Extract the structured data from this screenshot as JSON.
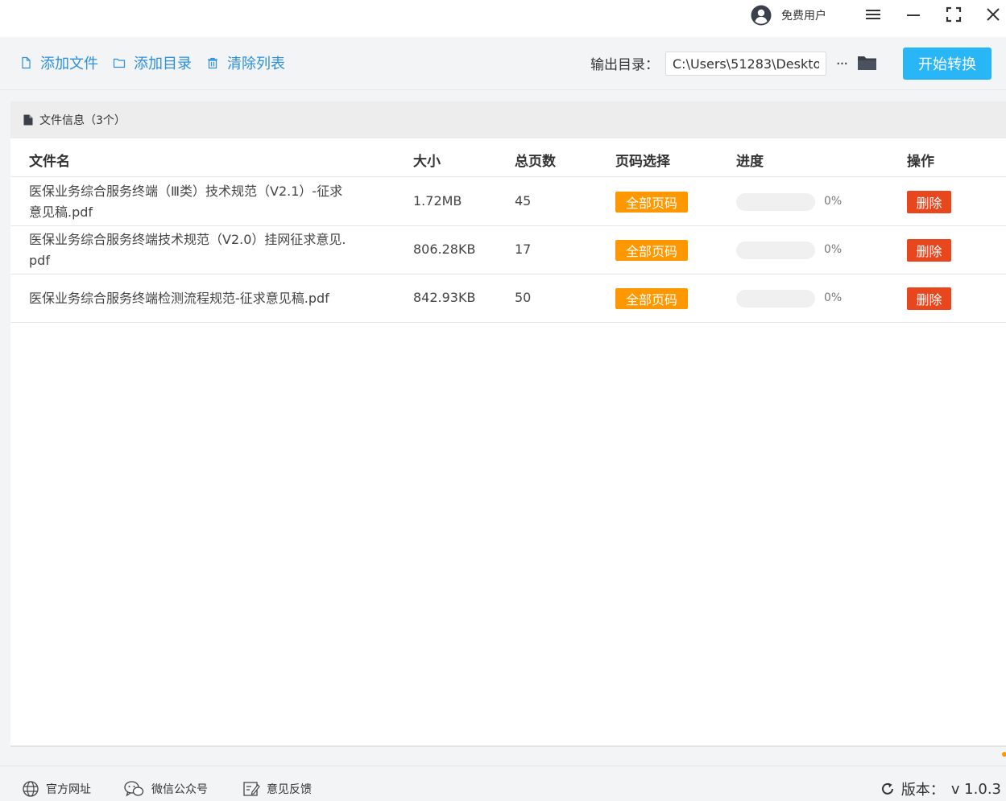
{
  "titlebar": {
    "user_label": "免费用户",
    "icons": [
      "user-avatar-icon",
      "menu-icon",
      "minimize-icon",
      "maximize-icon",
      "close-icon"
    ]
  },
  "toolbar": {
    "add_file": "添加文件",
    "add_dir": "添加目录",
    "clear_list": "清除列表",
    "output_label": "输出目录：",
    "output_path": "C:\\Users\\51283\\Deskto",
    "more_label": "···",
    "start_button": "开始转换"
  },
  "file_panel": {
    "header": "文件信息（3个）",
    "columns": {
      "name": "文件名",
      "size": "大小",
      "pages": "总页数",
      "page_select": "页码选择",
      "progress": "进度",
      "action": "操作"
    },
    "rows": [
      {
        "name_line1": "医保业务综合服务终端（Ⅲ类）技术规范（V2.1）-征求",
        "name_line2": "意见稿.pdf",
        "size": "1.72MB",
        "pages": "45",
        "page_select": "全部页码",
        "progress_value": 0,
        "progress_text": "0%",
        "action": "删除"
      },
      {
        "name_line1": "医保业务综合服务终端技术规范（V2.0）挂网征求意见.",
        "name_line2": "pdf",
        "size": "806.28KB",
        "pages": "17",
        "page_select": "全部页码",
        "progress_value": 0,
        "progress_text": "0%",
        "action": "删除"
      },
      {
        "name_line1": "医保业务综合服务终端检测流程规范-征求意见稿.pdf",
        "name_line2": "",
        "size": "842.93KB",
        "pages": "50",
        "page_select": "全部页码",
        "progress_value": 0,
        "progress_text": "0%",
        "action": "删除"
      }
    ]
  },
  "footer": {
    "website": "官方网址",
    "wechat": "微信公众号",
    "feedback": "意见反馈",
    "version_label": "版本：",
    "version_value": "v 1.0.3"
  },
  "colors": {
    "accent_blue": "#29b6f6",
    "link_blue": "#2c8fdc",
    "tag_orange": "#ff9800",
    "delete_red": "#e8461c"
  }
}
